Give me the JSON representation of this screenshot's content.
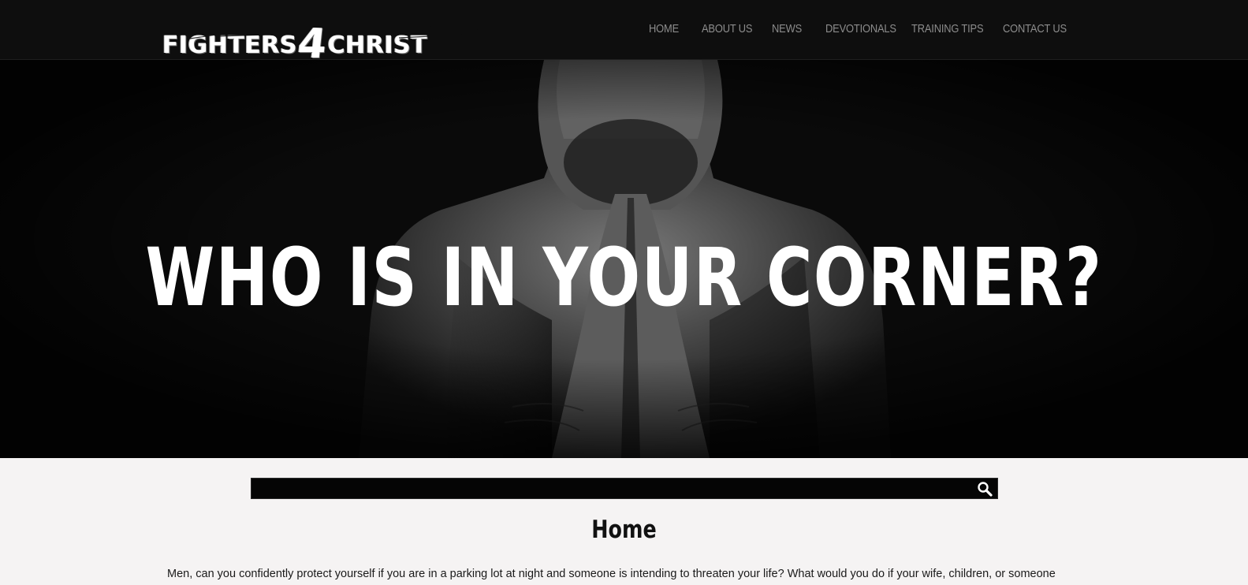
{
  "header": {
    "logo_text_left": "FIGHTERS",
    "logo_text_number": "4",
    "logo_text_right": "CHRIST",
    "nav": [
      {
        "label": "HOME"
      },
      {
        "label": "ABOUT US"
      },
      {
        "label": "NEWS"
      },
      {
        "label": "DEVOTIONALS"
      },
      {
        "label": "TRAINING TIPS"
      },
      {
        "label": "CONTACT US"
      }
    ]
  },
  "hero": {
    "title": "WHO IS IN YOUR CORNER?"
  },
  "search": {
    "value": "",
    "icon": "search-icon"
  },
  "main": {
    "title": "Home",
    "intro": "Men, can you confidently protect yourself if you are in a parking lot at night and someone is intending to threaten your life? What would you do if your wife, children, or someone"
  },
  "colors": {
    "header_bg": "#0e0e0e",
    "nav_text": "#8c8c8c",
    "hero_bg": "#0a0a0a",
    "page_bg": "#f5f3f3",
    "search_bg": "#050505"
  }
}
